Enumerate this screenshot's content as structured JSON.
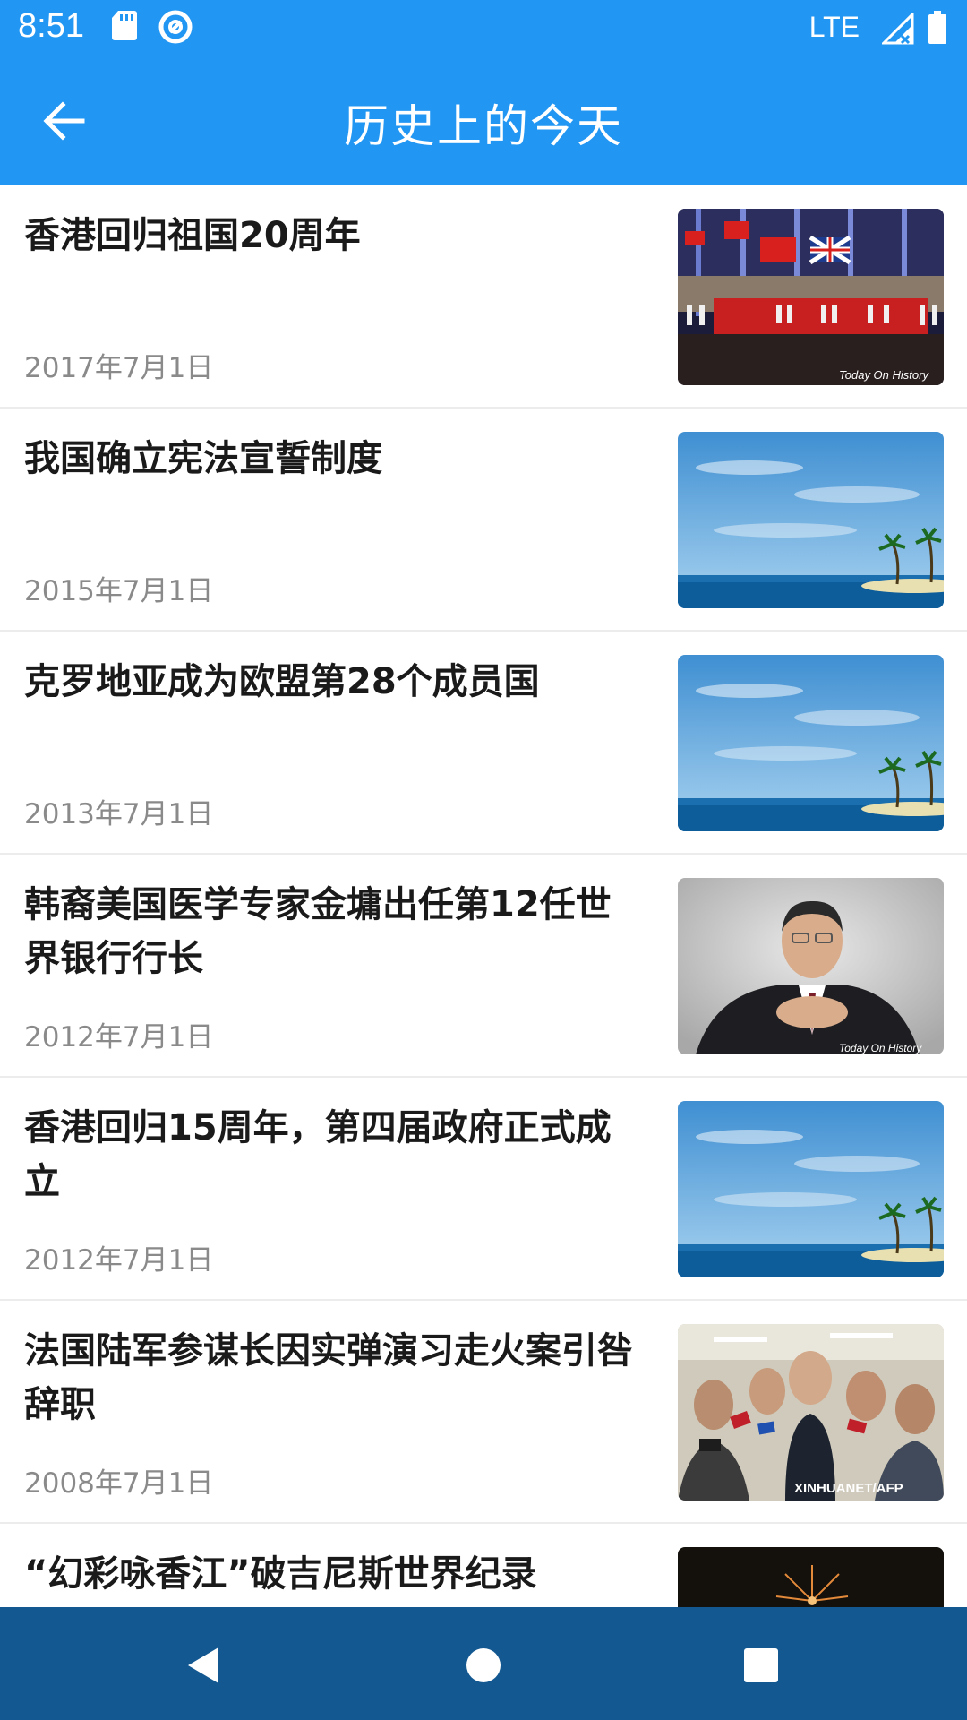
{
  "status_bar": {
    "time": "8:51",
    "network": "LTE",
    "icons": [
      "sd-card-icon",
      "at-sign-icon",
      "signal-icon",
      "battery-icon"
    ]
  },
  "app_bar": {
    "title": "历史上的今天",
    "back_icon": "back-arrow-icon",
    "color": "#2196F3"
  },
  "events": [
    {
      "title": "香港回归祖国20周年",
      "date": "2017年7月1日",
      "image": "ceremony-photo",
      "watermark": "Today On History"
    },
    {
      "title": "我国确立宪法宣誓制度",
      "date": "2015年7月1日",
      "image": "sea-palm-illustration"
    },
    {
      "title": "克罗地亚成为欧盟第28个成员国",
      "date": "2013年7月1日",
      "image": "sea-palm-illustration"
    },
    {
      "title": "韩裔美国医学专家金墉出任第12任世界银行行长",
      "date": "2012年7月1日",
      "image": "portrait-photo",
      "watermark": "Today On History"
    },
    {
      "title": "香港回归15周年，第四届政府正式成立",
      "date": "2012年7月1日",
      "image": "sea-palm-illustration"
    },
    {
      "title": "法国陆军参谋长因实弹演习走火案引咎辞职",
      "date": "2008年7月1日",
      "image": "press-photo",
      "watermark": "XINHUANET/AFP"
    },
    {
      "title": "“幻彩咏香江”破吉尼斯世界纪录",
      "date": "",
      "image": "fireworks-photo"
    }
  ],
  "nav_bar": {
    "buttons": [
      "back-triangle-icon",
      "home-circle-icon",
      "recents-square-icon"
    ],
    "color": "#135891"
  }
}
